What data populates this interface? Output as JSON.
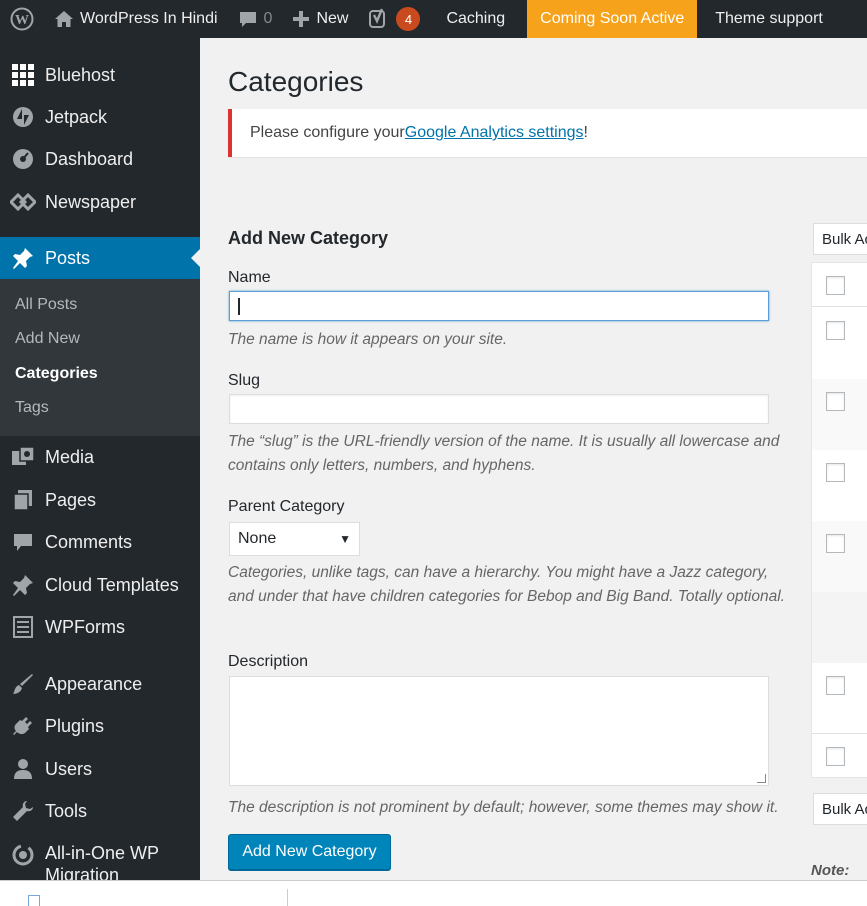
{
  "admin_bar": {
    "site_name": "WordPress In Hindi",
    "comments_count": "0",
    "new_label": "New",
    "yoast_badge": "4",
    "caching_label": "Caching",
    "coming_soon_label": "Coming Soon Active",
    "theme_support_label": "Theme support",
    "coming_soon_color": "#f7a21b",
    "badge_color": "#ca4a1f"
  },
  "sidebar": {
    "items": [
      {
        "label": "Bluehost",
        "icon": "grid-icon"
      },
      {
        "label": "Jetpack",
        "icon": "jetpack-icon"
      },
      {
        "label": "Dashboard",
        "icon": "dashboard-icon"
      },
      {
        "label": "Newspaper",
        "icon": "newspaper-icon"
      },
      {
        "label": "Posts",
        "icon": "pushpin-icon"
      },
      {
        "label": "Media",
        "icon": "media-icon"
      },
      {
        "label": "Pages",
        "icon": "pages-icon"
      },
      {
        "label": "Comments",
        "icon": "comments-icon"
      },
      {
        "label": "Cloud Templates",
        "icon": "pushpin-icon"
      },
      {
        "label": "WPForms",
        "icon": "forms-icon"
      },
      {
        "label": "Appearance",
        "icon": "brush-icon"
      },
      {
        "label": "Plugins",
        "icon": "plug-icon"
      },
      {
        "label": "Users",
        "icon": "user-icon"
      },
      {
        "label": "Tools",
        "icon": "wrench-icon"
      },
      {
        "label": "All-in-One WP Migration",
        "icon": "migration-icon"
      }
    ],
    "submenu": [
      "All Posts",
      "Add New",
      "Categories",
      "Tags"
    ],
    "active_color": "#0073aa"
  },
  "main": {
    "title": "Categories",
    "notice": {
      "prefix": "Please configure your ",
      "link": "Google Analytics settings",
      "suffix": "!"
    },
    "form": {
      "title": "Add New Category",
      "name_label": "Name",
      "name_value": "",
      "name_help": "The name is how it appears on your site.",
      "slug_label": "Slug",
      "slug_value": "",
      "slug_help": "The “slug” is the URL-friendly version of the name. It is usually all lowercase and contains only letters, numbers, and hyphens.",
      "parent_label": "Parent Category",
      "parent_value": "None",
      "parent_help": "Categories, unlike tags, can have a hierarchy. You might have a Jazz category, and under that have children categories for Bebop and Big Band. Totally optional.",
      "description_label": "Description",
      "description_value": "",
      "description_help": "The description is not prominent by default; however, some themes may show it.",
      "submit_label": "Add New Category"
    },
    "list": {
      "bulk_top": "Bulk Ac",
      "bulk_bottom": "Bulk Ac",
      "note": "Note:"
    }
  }
}
